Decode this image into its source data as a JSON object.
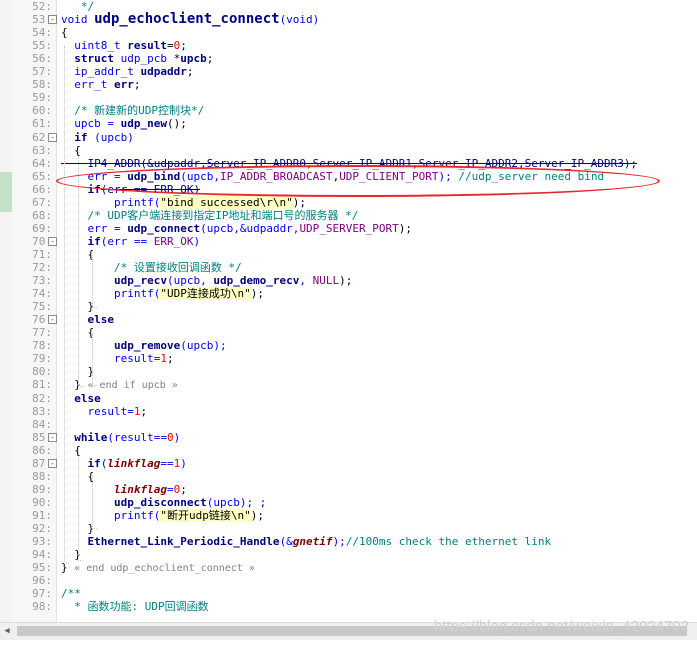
{
  "editor": {
    "lines": [
      {
        "n": "52",
        "fold": "",
        "tokens": [
          {
            "t": "   */",
            "c": "cm"
          }
        ]
      },
      {
        "n": "53",
        "fold": "-",
        "tokens": [
          {
            "t": "void ",
            "c": "kwn"
          },
          {
            "t": "udp_echoclient_connect",
            "c": "fnbig"
          },
          {
            "t": "(void)",
            "c": "kwn"
          }
        ]
      },
      {
        "n": "54",
        "fold": "",
        "tokens": [
          {
            "t": "{",
            "c": "plain"
          }
        ]
      },
      {
        "n": "55",
        "fold": "",
        "tokens": [
          {
            "t": "  uint8_t ",
            "c": "kwn"
          },
          {
            "t": "result",
            "c": "var"
          },
          {
            "t": "=",
            "c": "plain"
          },
          {
            "t": "0",
            "c": "num"
          },
          {
            "t": ";",
            "c": "plain"
          }
        ]
      },
      {
        "n": "56",
        "fold": "",
        "tokens": [
          {
            "t": "  struct ",
            "c": "kw"
          },
          {
            "t": "udp_pcb ",
            "c": "kwn"
          },
          {
            "t": "*",
            "c": "plain"
          },
          {
            "t": "upcb",
            "c": "var"
          },
          {
            "t": ";",
            "c": "plain"
          }
        ]
      },
      {
        "n": "57",
        "fold": "",
        "tokens": [
          {
            "t": "  ip_addr_t ",
            "c": "kwn"
          },
          {
            "t": "udpaddr",
            "c": "var"
          },
          {
            "t": ";",
            "c": "plain"
          }
        ]
      },
      {
        "n": "58",
        "fold": "",
        "tokens": [
          {
            "t": "  err_t ",
            "c": "kwn"
          },
          {
            "t": "err",
            "c": "var"
          },
          {
            "t": ";",
            "c": "plain"
          }
        ]
      },
      {
        "n": "59",
        "fold": "",
        "tokens": []
      },
      {
        "n": "60",
        "fold": "",
        "tokens": [
          {
            "t": "  /* 新建新的UDP控制块*/",
            "c": "cm"
          }
        ]
      },
      {
        "n": "61",
        "fold": "",
        "tokens": [
          {
            "t": "  upcb = ",
            "c": "kwn"
          },
          {
            "t": "udp_new",
            "c": "fnb"
          },
          {
            "t": "();",
            "c": "plain"
          }
        ]
      },
      {
        "n": "62",
        "fold": "-",
        "tokens": [
          {
            "t": "  if ",
            "c": "kw"
          },
          {
            "t": "(upcb)",
            "c": "kwn"
          }
        ]
      },
      {
        "n": "63",
        "fold": "",
        "tokens": [
          {
            "t": "  {",
            "c": "plain"
          }
        ]
      },
      {
        "n": "64",
        "fold": "",
        "tokens": [
          {
            "t": "    IP4_ADDR(&udpaddr,Server_IP_ADDR0,Server_IP_ADDR1,Server_IP_ADDR2,Server_IP_ADDR3);",
            "c": "strike"
          }
        ]
      },
      {
        "n": "65",
        "fold": "",
        "tokens": [
          {
            "t": "    err = ",
            "c": "kwn"
          },
          {
            "t": "udp_bind",
            "c": "fnb"
          },
          {
            "t": "(upcb,",
            "c": "kwn"
          },
          {
            "t": "IP_ADDR_BROADCAST",
            "c": "mac"
          },
          {
            "t": ",",
            "c": "plain"
          },
          {
            "t": "UDP_CLIENT_PORT",
            "c": "mac"
          },
          {
            "t": "); ",
            "c": "kwn"
          },
          {
            "t": "//udp_server need bind",
            "c": "cm"
          }
        ]
      },
      {
        "n": "66",
        "fold": "",
        "tokens": [
          {
            "t": "    if",
            "c": "kw"
          },
          {
            "t": "(err == ERR_OK)",
            "c": "strike"
          }
        ]
      },
      {
        "n": "67",
        "fold": "",
        "tokens": [
          {
            "t": "        printf(",
            "c": "kwn"
          },
          {
            "t": "\"bind successed\\r\\n\"",
            "c": "str"
          },
          {
            "t": ");",
            "c": "plain"
          }
        ]
      },
      {
        "n": "68",
        "fold": "",
        "tokens": [
          {
            "t": "    /* UDP客户端连接到指定IP地址和端口号的服务器 */",
            "c": "cm"
          }
        ]
      },
      {
        "n": "69",
        "fold": "",
        "tokens": [
          {
            "t": "    err = ",
            "c": "kwn"
          },
          {
            "t": "udp_connect",
            "c": "fnb"
          },
          {
            "t": "(upcb,&udpaddr,",
            "c": "kwn"
          },
          {
            "t": "UDP_SERVER_PORT",
            "c": "mac"
          },
          {
            "t": ");",
            "c": "plain"
          }
        ]
      },
      {
        "n": "70",
        "fold": "-",
        "tokens": [
          {
            "t": "    if",
            "c": "kw"
          },
          {
            "t": "(err == ",
            "c": "kwn"
          },
          {
            "t": "ERR_OK",
            "c": "mac"
          },
          {
            "t": ")",
            "c": "kwn"
          }
        ]
      },
      {
        "n": "71",
        "fold": "",
        "tokens": [
          {
            "t": "    {",
            "c": "plain"
          }
        ]
      },
      {
        "n": "72",
        "fold": "",
        "tokens": [
          {
            "t": "        /* 设置接收回调函数 */",
            "c": "cm"
          }
        ]
      },
      {
        "n": "73",
        "fold": "",
        "tokens": [
          {
            "t": "        ",
            "c": "plain"
          },
          {
            "t": "udp_recv",
            "c": "fnb"
          },
          {
            "t": "(upcb, ",
            "c": "kwn"
          },
          {
            "t": "udp_demo_recv",
            "c": "fnb"
          },
          {
            "t": ", ",
            "c": "kwn"
          },
          {
            "t": "NULL",
            "c": "mac"
          },
          {
            "t": ");",
            "c": "plain"
          }
        ]
      },
      {
        "n": "74",
        "fold": "",
        "tokens": [
          {
            "t": "        printf(",
            "c": "kwn"
          },
          {
            "t": "\"UDP连接成功\\n\"",
            "c": "str"
          },
          {
            "t": ");",
            "c": "plain"
          }
        ]
      },
      {
        "n": "75",
        "fold": "",
        "tokens": [
          {
            "t": "    }",
            "c": "plain"
          }
        ]
      },
      {
        "n": "76",
        "fold": "-",
        "tokens": [
          {
            "t": "    else",
            "c": "kw"
          }
        ]
      },
      {
        "n": "77",
        "fold": "",
        "tokens": [
          {
            "t": "    {",
            "c": "plain"
          }
        ]
      },
      {
        "n": "78",
        "fold": "",
        "tokens": [
          {
            "t": "        ",
            "c": "plain"
          },
          {
            "t": "udp_remove",
            "c": "fnb"
          },
          {
            "t": "(upcb);",
            "c": "kwn"
          }
        ]
      },
      {
        "n": "79",
        "fold": "",
        "tokens": [
          {
            "t": "        result=",
            "c": "kwn"
          },
          {
            "t": "1",
            "c": "num"
          },
          {
            "t": ";",
            "c": "plain"
          }
        ]
      },
      {
        "n": "80",
        "fold": "",
        "tokens": [
          {
            "t": "    }",
            "c": "plain"
          }
        ]
      },
      {
        "n": "81",
        "fold": "",
        "tokens": [
          {
            "t": "  } ",
            "c": "plain"
          },
          {
            "t": "« end if upcb »",
            "c": "endc"
          }
        ]
      },
      {
        "n": "82",
        "fold": "",
        "tokens": [
          {
            "t": "  else",
            "c": "kw"
          }
        ]
      },
      {
        "n": "83",
        "fold": "",
        "tokens": [
          {
            "t": "    result=",
            "c": "kwn"
          },
          {
            "t": "1",
            "c": "num"
          },
          {
            "t": ";",
            "c": "plain"
          }
        ]
      },
      {
        "n": "84",
        "fold": "",
        "tokens": []
      },
      {
        "n": "85",
        "fold": "-",
        "tokens": [
          {
            "t": "  while",
            "c": "kw"
          },
          {
            "t": "(result==",
            "c": "kwn"
          },
          {
            "t": "0",
            "c": "num"
          },
          {
            "t": ")",
            "c": "kwn"
          }
        ]
      },
      {
        "n": "86",
        "fold": "",
        "tokens": [
          {
            "t": "  {",
            "c": "plain"
          }
        ]
      },
      {
        "n": "87",
        "fold": "-",
        "tokens": [
          {
            "t": "    if",
            "c": "kw"
          },
          {
            "t": "(",
            "c": "kwn"
          },
          {
            "t": "linkflag",
            "c": "ital"
          },
          {
            "t": "==",
            "c": "kwn"
          },
          {
            "t": "1",
            "c": "num"
          },
          {
            "t": ")",
            "c": "kwn"
          }
        ]
      },
      {
        "n": "88",
        "fold": "",
        "tokens": [
          {
            "t": "    {",
            "c": "plain"
          }
        ]
      },
      {
        "n": "89",
        "fold": "",
        "tokens": [
          {
            "t": "        ",
            "c": "plain"
          },
          {
            "t": "linkflag",
            "c": "ital"
          },
          {
            "t": "=",
            "c": "kwn"
          },
          {
            "t": "0",
            "c": "num"
          },
          {
            "t": ";",
            "c": "plain"
          }
        ]
      },
      {
        "n": "90",
        "fold": "",
        "tokens": [
          {
            "t": "        ",
            "c": "plain"
          },
          {
            "t": "udp_disconnect",
            "c": "fnb"
          },
          {
            "t": "(upcb); ;",
            "c": "kwn"
          }
        ]
      },
      {
        "n": "91",
        "fold": "",
        "tokens": [
          {
            "t": "        printf(",
            "c": "kwn"
          },
          {
            "t": "\"断开udp链接\\n\"",
            "c": "str"
          },
          {
            "t": ");",
            "c": "plain"
          }
        ]
      },
      {
        "n": "92",
        "fold": "",
        "tokens": [
          {
            "t": "    }",
            "c": "plain"
          }
        ]
      },
      {
        "n": "93",
        "fold": "",
        "tokens": [
          {
            "t": "    ",
            "c": "plain"
          },
          {
            "t": "Ethernet_Link_Periodic_Handle",
            "c": "fnb"
          },
          {
            "t": "(&",
            "c": "kwn"
          },
          {
            "t": "gnetif",
            "c": "ital"
          },
          {
            "t": ");",
            "c": "kwn"
          },
          {
            "t": "//100ms check the ethernet link",
            "c": "cm"
          }
        ]
      },
      {
        "n": "94",
        "fold": "",
        "tokens": [
          {
            "t": "  }",
            "c": "plain"
          }
        ]
      },
      {
        "n": "95",
        "fold": "",
        "tokens": [
          {
            "t": "} ",
            "c": "plain"
          },
          {
            "t": "« end udp_echoclient_connect »",
            "c": "endc"
          }
        ]
      },
      {
        "n": "96",
        "fold": "",
        "tokens": []
      },
      {
        "n": "97",
        "fold": "",
        "tokens": [
          {
            "t": "/**",
            "c": "cm"
          }
        ]
      },
      {
        "n": "98",
        "fold": "",
        "tokens": [
          {
            "t": "  * 函数功能: UDP回调函数",
            "c": "cm"
          }
        ]
      }
    ]
  },
  "colors": {
    "highlight_ellipse": "#e8282a",
    "gutter_change_mark": "#c5e1c5"
  },
  "watermark": "https://blog.csdn.net/weixin_42024702",
  "scrollbar": {
    "left_arrow_icon": "chevron-left-icon"
  }
}
